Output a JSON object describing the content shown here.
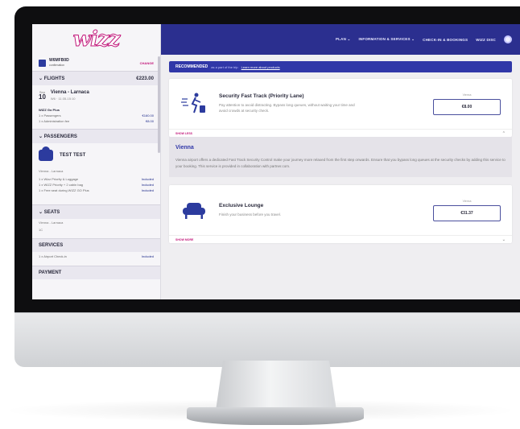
{
  "sidebar": {
    "logo": "wizz",
    "booking": {
      "code": "W6MFB0D",
      "sub": "confirmation",
      "status": "CHANGE"
    },
    "flights": {
      "label": "FLIGHTS",
      "amount": "€223.00",
      "day": "10",
      "month": "Sep",
      "route": "Vienna - Larnaca",
      "route_sub": "W6 · 11:35-15:10",
      "lines": [
        {
          "label": "WIZZ Go Plus",
          "value": ""
        },
        {
          "label": "1 x Passengers",
          "value": "€160.00"
        },
        {
          "label": "1 x Administration fee",
          "value": "€8.00"
        }
      ]
    },
    "passengers": {
      "label": "PASSENGERS",
      "name": "TEST TEST",
      "sub": "Vienna - Larnaca",
      "lines": [
        {
          "label": "1 x Wizz Priority & Luggage",
          "value": "Included"
        },
        {
          "label": "1 x WIZZ Priority + 2 cabin bag",
          "value": "Included"
        },
        {
          "label": "1 x Free seat during WIZZ GO Plus",
          "value": "Included"
        }
      ]
    },
    "seats": {
      "label": "SEATS",
      "sub": "Vienna - Larnaca",
      "value": "1C"
    },
    "services": {
      "label": "SERVICES",
      "line": "1 x Airport Check-in",
      "value": "Included"
    },
    "payment": {
      "label": "PAYMENT"
    }
  },
  "topnav": {
    "items": [
      "PLAN",
      "INFORMATION & SERVICES",
      "CHECK-IN & BOOKINGS",
      "WIZZ DISC"
    ]
  },
  "main": {
    "reco_title": "RECOMMENDED",
    "reco_sub": "as a part of the trip",
    "reco_link": "Learn more about products",
    "card1": {
      "title": "Security Fast Track (Priority Lane)",
      "desc": "Pay attention to avoid distracting. Bypass long queues, without waiting your time and avoid crowds at security check.",
      "price_label": "Vienna",
      "price": "€8.00",
      "foot": "SHOW LESS"
    },
    "info": {
      "title": "Vienna",
      "text": "Vienna airport offers a dedicated Fast Track Security Control make your journey more relaxed from the first step onwards. Ensure that you bypass long queues at the security checks by adding this service to your booking. This service is provided in collaboration with partner.com."
    },
    "card2": {
      "title": "Exclusive Lounge",
      "desc": "Finish your business before you travel.",
      "price_label": "Vienna",
      "price": "€31.37",
      "foot": "SHOW MORE"
    }
  }
}
